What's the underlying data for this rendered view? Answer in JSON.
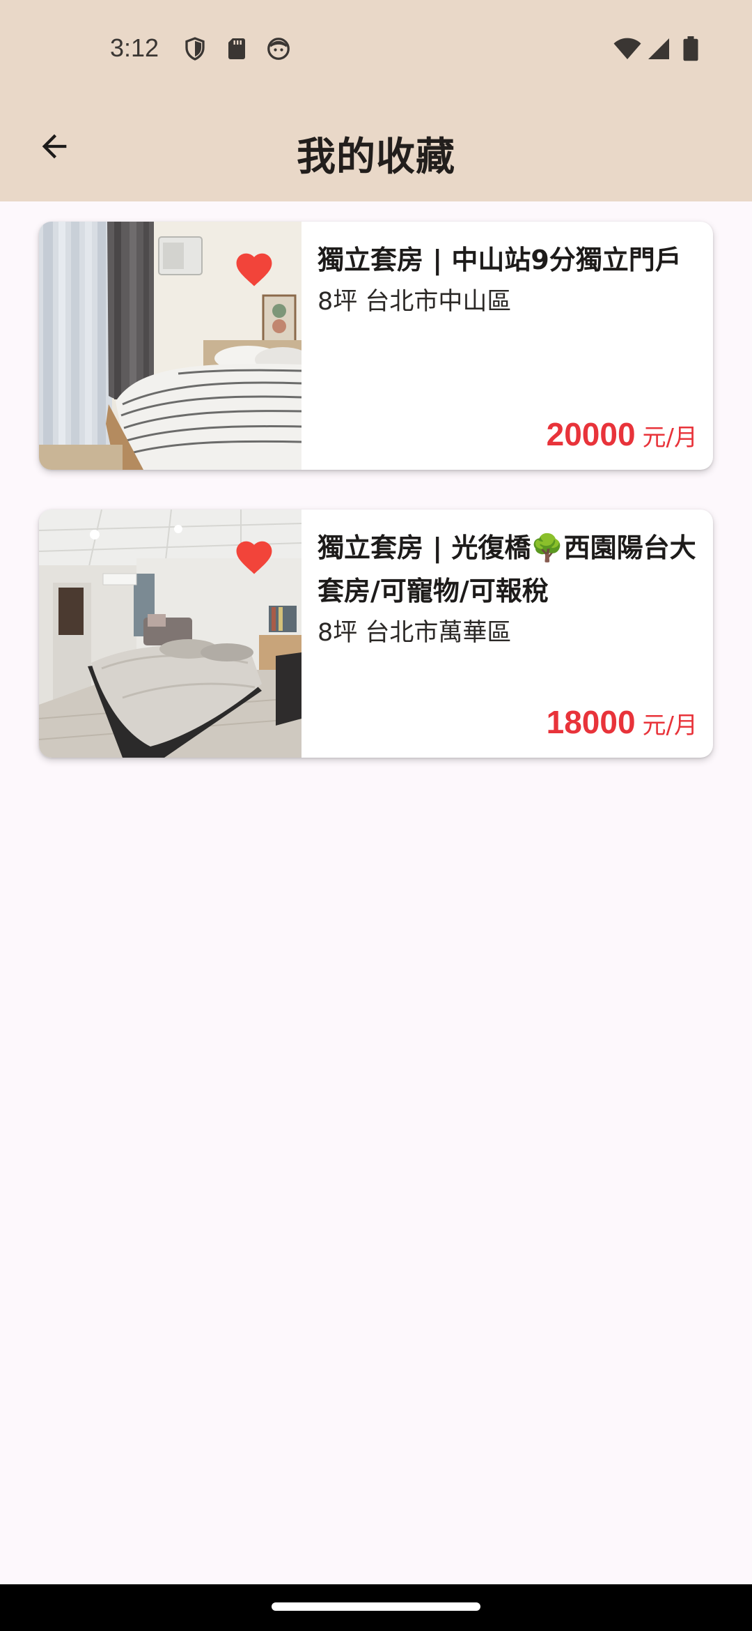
{
  "status_bar": {
    "time": "3:12",
    "left_icons": [
      "shield-icon",
      "sd-card-icon",
      "face-icon"
    ],
    "right_icons": [
      "wifi-icon",
      "signal-icon",
      "battery-icon"
    ]
  },
  "app_bar": {
    "back_icon": "arrow-left-icon",
    "title": "我的收藏"
  },
  "favorites": [
    {
      "title": "獨立套房 | 中山站9分獨立門戶",
      "size_location": "8坪 台北市中山區",
      "price": "20000",
      "unit": "元/月",
      "favorited": true
    },
    {
      "title": "獨立套房 | 光復橋🌳西園陽台大套房/可寵物/可報稅",
      "size_location": "8坪 台北市萬華區",
      "price": "18000",
      "unit": "元/月",
      "favorited": true
    }
  ],
  "colors": {
    "header_bg": "#e9d8c8",
    "page_bg": "#fdf8fc",
    "price": "#e8333a",
    "heart": "#f2443a"
  }
}
